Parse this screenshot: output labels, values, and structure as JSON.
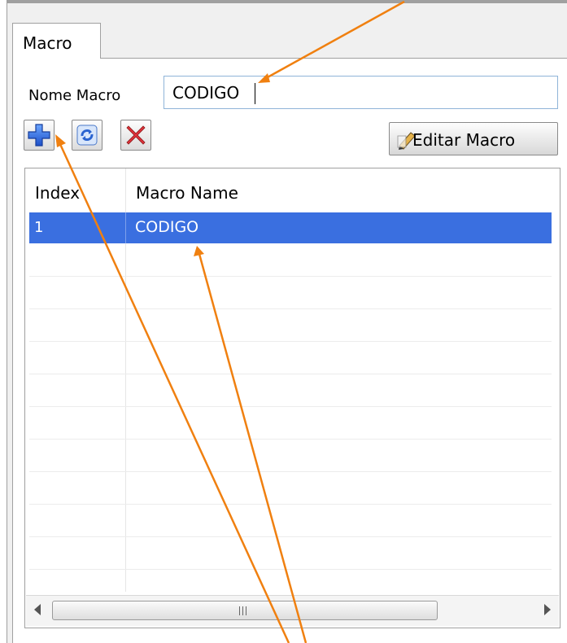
{
  "tabs": [
    {
      "label": "Macro"
    }
  ],
  "form": {
    "name_label": "Nome Macro",
    "name_value": "CODIGO"
  },
  "toolbar": {
    "add_icon": "plus-icon",
    "refresh_icon": "refresh-icon",
    "delete_icon": "delete-x-icon",
    "edit_label": "Editar Macro",
    "edit_icon": "pencil-icon"
  },
  "grid": {
    "columns": [
      "Index",
      "Macro Name"
    ],
    "rows": [
      {
        "index": "1",
        "name": "CODIGO",
        "selected": true
      }
    ],
    "scroll_grip": "III"
  },
  "colors": {
    "selection": "#3a6fe0",
    "annotation_arrow": "#f08010"
  }
}
